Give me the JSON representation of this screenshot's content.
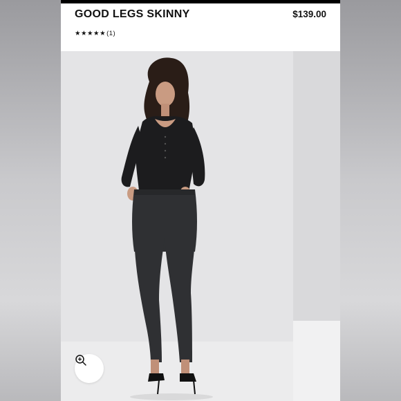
{
  "product": {
    "title": "GOOD LEGS SKINNY",
    "price": "$139.00",
    "stars": "★★★★★",
    "review_count": "(1)",
    "rating": 5
  },
  "icons": {
    "zoom": "zoom-in-icon"
  }
}
